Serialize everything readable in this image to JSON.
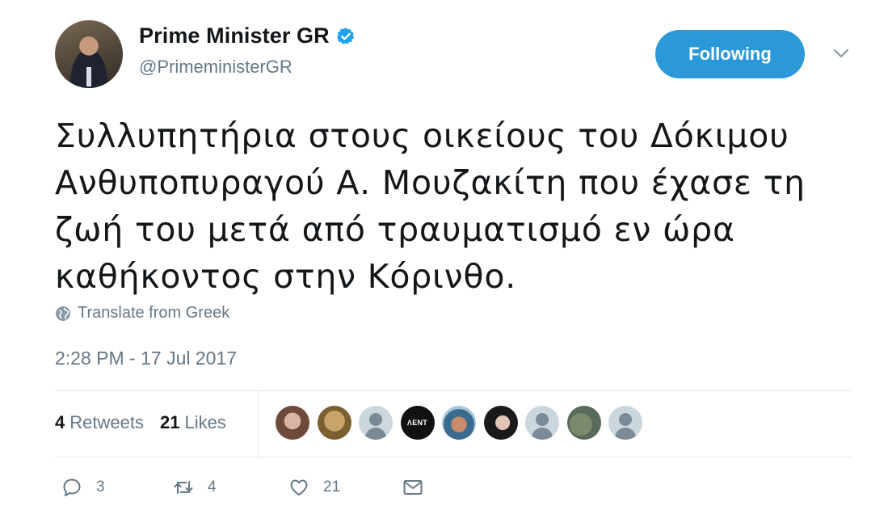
{
  "account": {
    "display_name": "Prime Minister GR",
    "handle": "@PrimeministerGR",
    "verified": true
  },
  "follow_button": {
    "label": "Following"
  },
  "tweet": {
    "text": "Συλλυπητήρια στους οικείους του Δόκιμου Ανθυποπυραγού Α. Μουζακίτη που έχασε τη ζωή του μετά από τραυματισμό εν ώρα καθήκοντος στην Κόρινθο.",
    "translate_label": "Translate from Greek",
    "timestamp": "2:28 PM - 17 Jul 2017"
  },
  "stats": {
    "retweets": {
      "count": "4",
      "label": "Retweets"
    },
    "likes": {
      "count": "21",
      "label": "Likes"
    }
  },
  "likers": [
    {
      "icon": "profile-photo"
    },
    {
      "icon": "profile-photo"
    },
    {
      "icon": "default-avatar"
    },
    {
      "icon": "profile-photo",
      "text": "ΛΕΝΤ"
    },
    {
      "icon": "profile-photo"
    },
    {
      "icon": "profile-photo"
    },
    {
      "icon": "default-avatar"
    },
    {
      "icon": "profile-photo"
    },
    {
      "icon": "default-avatar"
    }
  ],
  "actions": {
    "reply_count": "3",
    "retweet_count": "4",
    "like_count": "21"
  },
  "colors": {
    "accent": "#2b99d8",
    "secondary_text": "#657786",
    "divider": "#e1e8ed"
  }
}
